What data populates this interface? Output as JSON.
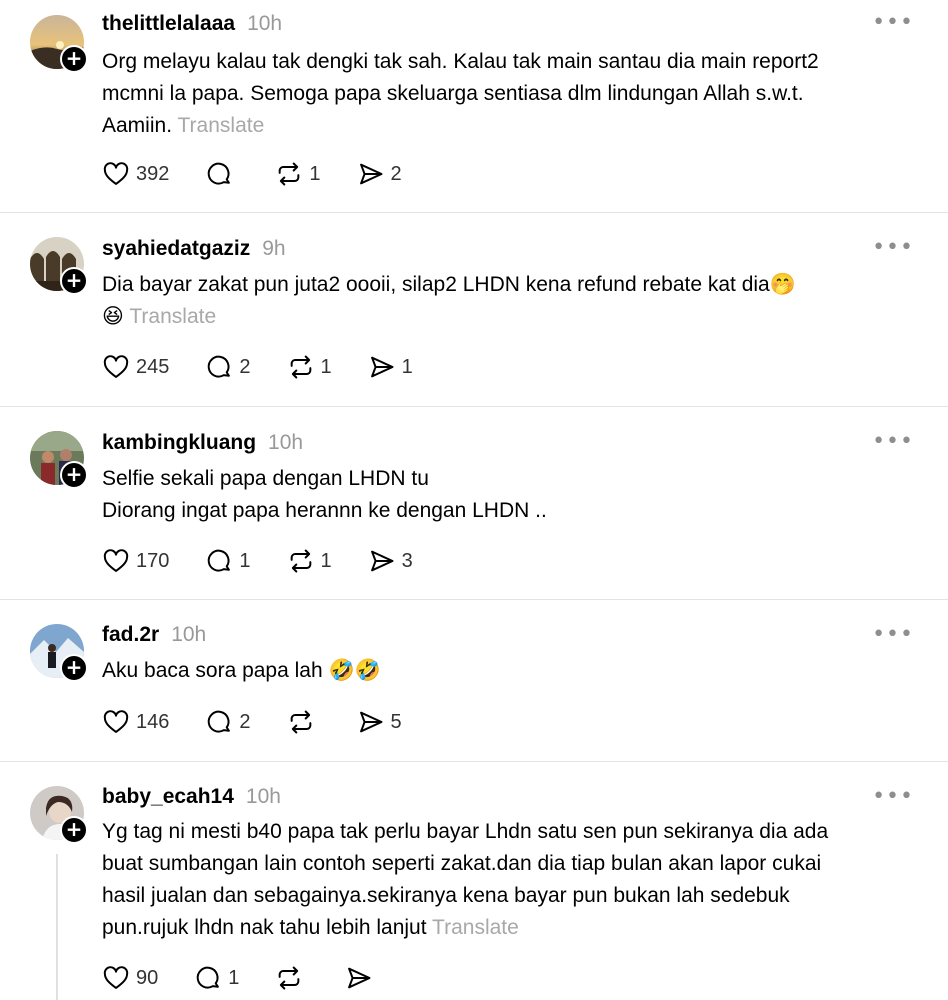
{
  "ui": {
    "more": "•••",
    "follow": "+"
  },
  "posts": [
    {
      "username": "thelittlelalaaa",
      "time": "10h",
      "text": "Org melayu kalau tak dengki tak sah. Kalau tak main santau dia main report2\nmcmni la papa. Semoga papa skeluarga sentiasa dlm lindungan Allah s.w.t.\nAamiin.",
      "translate": "Translate",
      "likes": "392",
      "replies": "",
      "reposts": "1",
      "shares": "2",
      "avatar_icon": "sunset-landscape"
    },
    {
      "username": "syahiedatgaziz",
      "time": "9h",
      "text": "Dia bayar zakat pun juta2 oooii, silap2 LHDN kena refund rebate kat dia🤭\n😆",
      "translate": "Translate",
      "likes": "245",
      "replies": "2",
      "reposts": "1",
      "shares": "1",
      "avatar_icon": "mosque-arches"
    },
    {
      "username": "kambingkluang",
      "time": "10h",
      "text": "Selfie sekali papa dengan LHDN tu\nDiorang ingat papa herannn ke dengan LHDN ..",
      "translate": "",
      "likes": "170",
      "replies": "1",
      "reposts": "1",
      "shares": "3",
      "avatar_icon": "group-photo"
    },
    {
      "username": "fad.2r",
      "time": "10h",
      "text": "Aku baca sora papa lah 🤣🤣",
      "translate": "",
      "likes": "146",
      "replies": "2",
      "reposts": "",
      "shares": "5",
      "avatar_icon": "snow-mountain-person"
    },
    {
      "username": "baby_ecah14",
      "time": "10h",
      "text": "Yg tag ni mesti b40 papa tak perlu bayar Lhdn satu sen pun sekiranya dia ada\nbuat sumbangan lain contoh seperti zakat.dan dia tiap bulan akan lapor cukai\nhasil jualan dan sebagainya.sekiranya kena bayar pun bukan lah sedebuk\npun.rujuk lhdn nak tahu lebih lanjut",
      "translate": "Translate",
      "likes": "90",
      "replies": "1",
      "reposts": "",
      "shares": "",
      "avatar_icon": "portrait-photo"
    }
  ]
}
